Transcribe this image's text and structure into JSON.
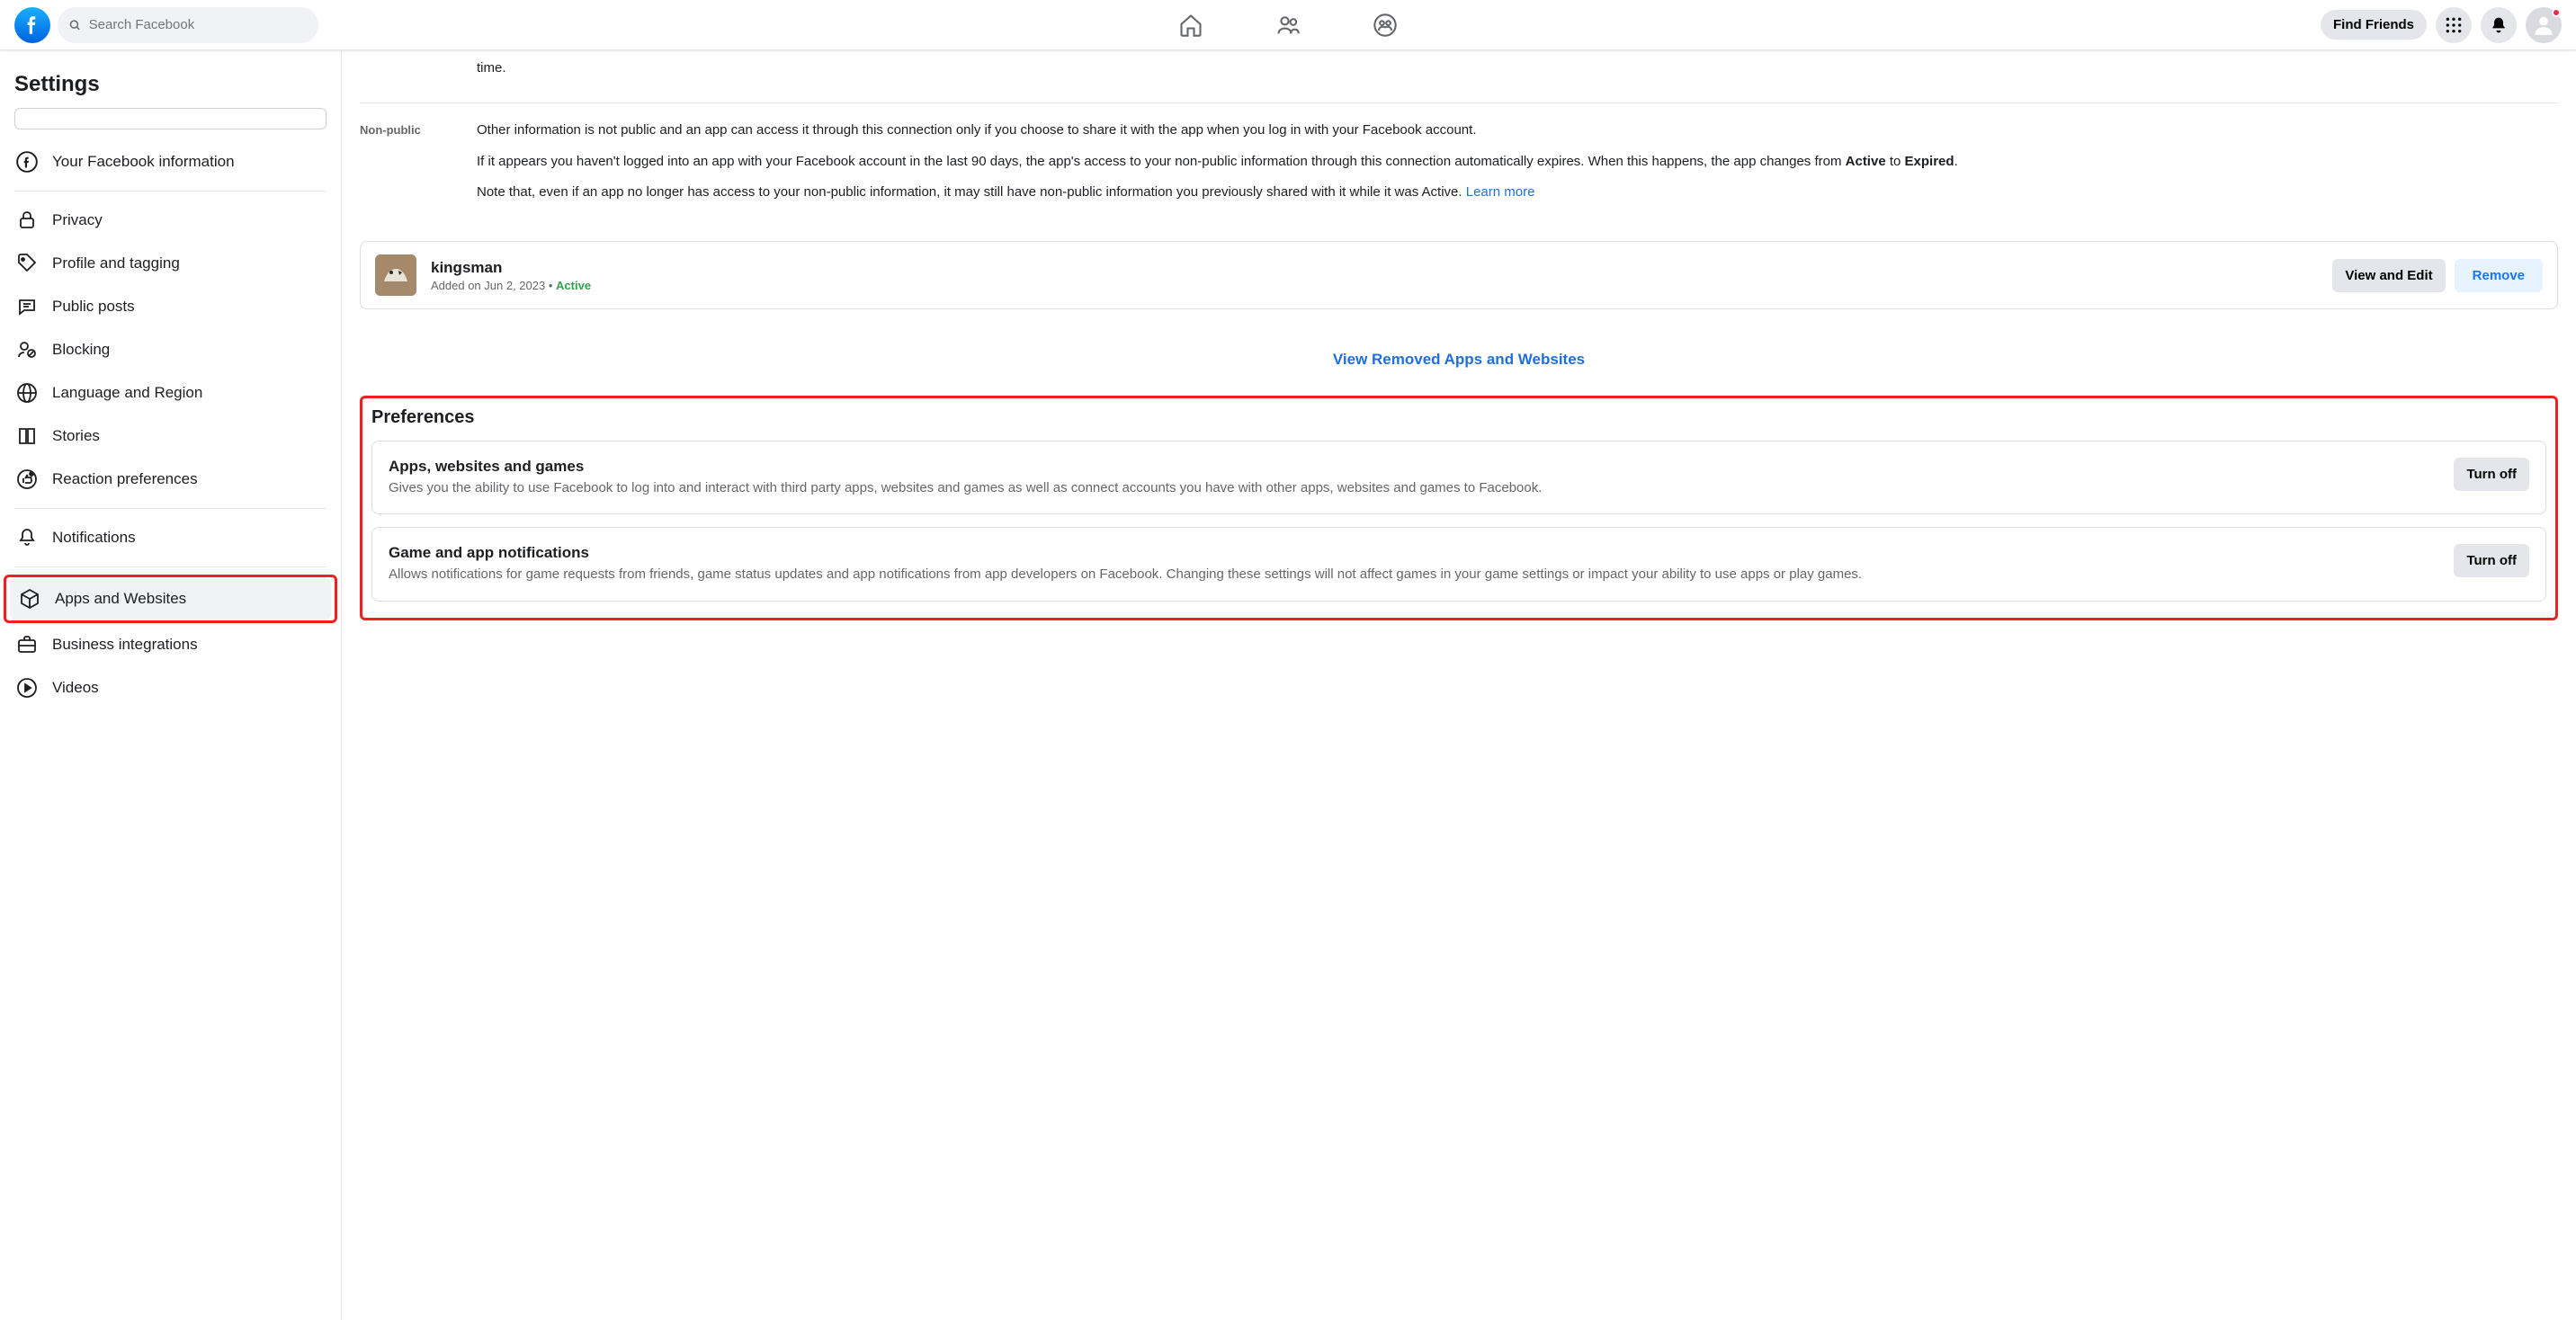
{
  "header": {
    "search_placeholder": "Search Facebook",
    "find_friends": "Find Friends"
  },
  "sidebar": {
    "title": "Settings",
    "items": [
      {
        "label": "Your Facebook information"
      },
      {
        "label": "Privacy"
      },
      {
        "label": "Profile and tagging"
      },
      {
        "label": "Public posts"
      },
      {
        "label": "Blocking"
      },
      {
        "label": "Language and Region"
      },
      {
        "label": "Stories"
      },
      {
        "label": "Reaction preferences"
      },
      {
        "label": "Notifications"
      },
      {
        "label": "Apps and Websites"
      },
      {
        "label": "Business integrations"
      },
      {
        "label": "Videos"
      }
    ]
  },
  "info": {
    "public_tail": "time.",
    "non_public_label": "Non-public",
    "p1": "Other information is not public and an app can access it through this connection only if you choose to share it with the app when you log in with your Facebook account.",
    "p2_pre": "If it appears you haven't logged into an app with your Facebook account in the last 90 days, the app's access to your non-public information through this connection automatically expires. When this happens, the app changes from ",
    "p2_b1": "Active",
    "p2_mid": " to ",
    "p2_b2": "Expired",
    "p2_post": ".",
    "p3_pre": "Note that, even if an app no longer has access to your non-public information, it may still have non-public information you previously shared with it while it was Active. ",
    "p3_link": "Learn more"
  },
  "app": {
    "name": "kingsman",
    "added_on": "Added on Jun 2, 2023",
    "dot": "•",
    "status": "Active",
    "view_edit": "View and Edit",
    "remove": "Remove"
  },
  "removed_link": "View Removed Apps and Websites",
  "preferences": {
    "title": "Preferences",
    "cards": [
      {
        "heading": "Apps, websites and games",
        "desc": "Gives you the ability to use Facebook to log into and interact with third party apps, websites and games as well as connect accounts you have with other apps, websites and games to Facebook.",
        "button": "Turn off"
      },
      {
        "heading": "Game and app notifications",
        "desc": "Allows notifications for game requests from friends, game status updates and app notifications from app developers on Facebook. Changing these settings will not affect games in your game settings or impact your ability to use apps or play games.",
        "button": "Turn off"
      }
    ]
  }
}
